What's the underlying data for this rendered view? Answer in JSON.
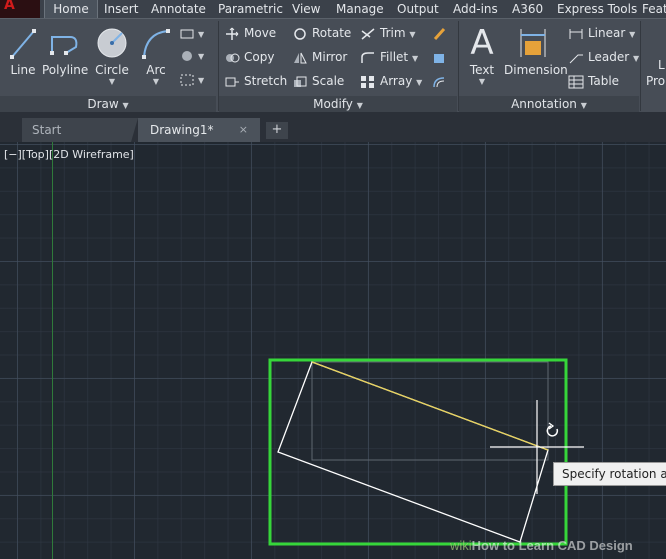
{
  "ribbon_tabs": [
    "Home",
    "Insert",
    "Annotate",
    "Parametric",
    "View",
    "Manage",
    "Output",
    "Add-ins",
    "A360",
    "Express Tools",
    "Featu"
  ],
  "active_tab": "Home",
  "panels": {
    "draw": {
      "title": "Draw",
      "tools": [
        "Line",
        "Polyline",
        "Circle",
        "Arc"
      ]
    },
    "modify": {
      "title": "Modify",
      "tools": [
        "Move",
        "Rotate",
        "Trim",
        "Copy",
        "Mirror",
        "Fillet",
        "Stretch",
        "Scale",
        "Array"
      ]
    },
    "annotation": {
      "title": "Annotation",
      "big_tools": [
        "Text",
        "Dimension"
      ],
      "small_tools": [
        "Linear",
        "Leader",
        "Table"
      ]
    },
    "layer_partial": [
      "L",
      "Prop"
    ]
  },
  "file_tabs": {
    "start": "Start",
    "drawing": "Drawing1*",
    "close": "×",
    "add": "+"
  },
  "viewport_label": "[−][Top][2D Wireframe]",
  "tooltip": "Specify rotation angle",
  "watermark": {
    "prefix": "wiki",
    "text": "How to Learn CAD Design"
  },
  "colors": {
    "canvas_bg": "#212830",
    "selection_window": "#36d63a",
    "rotating_shape": "#ffffff",
    "rubber_band": "#e8d25a",
    "app_logo": "#d11b1b"
  }
}
